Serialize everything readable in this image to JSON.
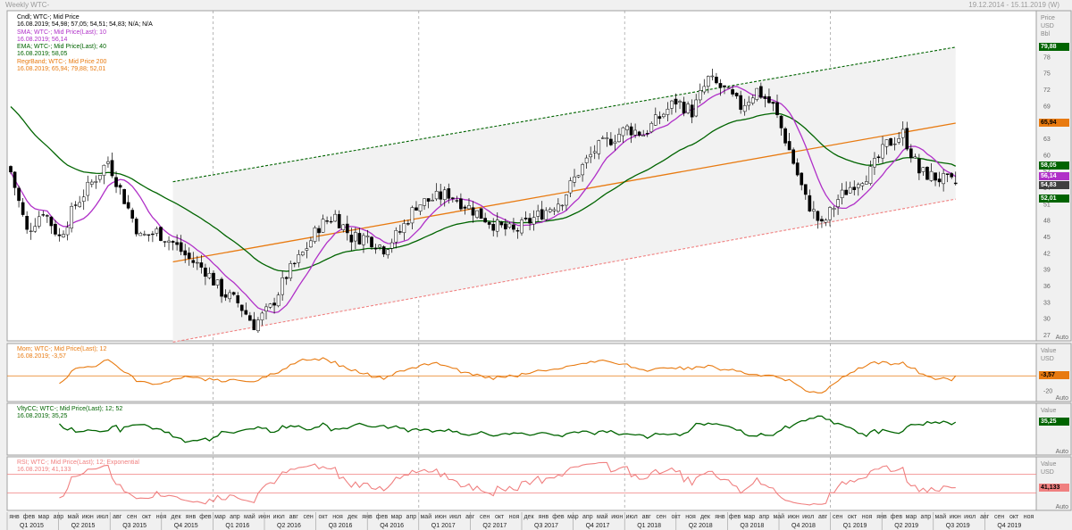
{
  "window": {
    "title": "Weekly WTC-",
    "range": "19.12.2014 - 15.11.2019 (W)"
  },
  "price_axis_header": [
    "Price",
    "USD",
    "Bbl"
  ],
  "value_axis_header": [
    "Value",
    "USD"
  ],
  "auto_label": "Auto",
  "legends": {
    "main": [
      {
        "text": "Cndl; WTC-; Mid Price",
        "color": "#000000"
      },
      {
        "text": "16.08.2019; 54,98; 57,05; 54,51; 54,83; N/A; N/A",
        "color": "#000000"
      },
      {
        "text": "SMA; WTC-; Mid Price(Last); 10",
        "color": "#b030c8"
      },
      {
        "text": "16.08.2019; 56,14",
        "color": "#b030c8"
      },
      {
        "text": "EMA; WTC-; Mid Price(Last); 40",
        "color": "#006400"
      },
      {
        "text": "16.08.2019; 58,05",
        "color": "#006400"
      },
      {
        "text": "RegrBand; WTC-; Mid Price 200",
        "color": "#e87a10"
      },
      {
        "text": "16.08.2019; 65,94; 79,88; 52,01",
        "color": "#e87a10"
      }
    ],
    "mom": [
      {
        "text": "Mom; WTC-; Mid Price(Last); 12",
        "color": "#e87a10"
      },
      {
        "text": "16.08.2019; -3,57",
        "color": "#e87a10"
      }
    ],
    "vhf": [
      {
        "text": "VltyCC; WTC-; Mid Price(Last); 12; 52",
        "color": "#006400"
      },
      {
        "text": "16.08.2019; 35,25",
        "color": "#006400"
      }
    ],
    "rsi": [
      {
        "text": "RSI; WTC-; Mid Price(Last); 12; Exponential",
        "color": "#f08080"
      },
      {
        "text": "16.08.2019; 41,133",
        "color": "#f08080"
      }
    ]
  },
  "badges": [
    {
      "id": "b1",
      "text": "79,88",
      "bg": "#006400",
      "fg": "#ffffff"
    },
    {
      "id": "b2",
      "text": "65,94",
      "bg": "#e87a10",
      "fg": "#000000"
    },
    {
      "id": "b3",
      "text": "58,05",
      "bg": "#006400",
      "fg": "#ffffff"
    },
    {
      "id": "b4",
      "text": "56,14",
      "bg": "#b030c8",
      "fg": "#ffffff"
    },
    {
      "id": "b5",
      "text": "54,83",
      "bg": "#404040",
      "fg": "#ffffff"
    },
    {
      "id": "b6",
      "text": "52,01",
      "bg": "#006400",
      "fg": "#ffffff"
    },
    {
      "id": "b7",
      "text": "-3,57",
      "bg": "#e87a10",
      "fg": "#000000"
    },
    {
      "id": "b8",
      "text": "35,25",
      "bg": "#006400",
      "fg": "#ffffff"
    },
    {
      "id": "b9",
      "text": "41,133",
      "bg": "#f08080",
      "fg": "#000000"
    }
  ],
  "colors": {
    "candle_up": "#ffffff",
    "candle_down": "#000000",
    "sma": "#b030c8",
    "ema": "#006400",
    "regr_mid": "#e87a10",
    "regr_upper": "#006400",
    "regr_lower": "#f08080",
    "mom": "#e87a10",
    "vhf": "#006400",
    "rsi": "#f08080",
    "rsi_levels": "#f08080"
  },
  "chart_data": {
    "type": "candlestick",
    "interval": "weekly",
    "instrument": "WTC-",
    "price_axis": {
      "min": 27,
      "max": 81,
      "ticks": [
        27,
        30,
        33,
        36,
        39,
        42,
        45,
        48,
        51,
        54,
        57,
        60,
        63,
        66,
        69,
        72,
        75,
        78
      ]
    },
    "mom_axis": {
      "min": -27,
      "max": 27,
      "ticks": [
        -20
      ]
    },
    "rsi_axis": {
      "levels": [
        30,
        70
      ]
    },
    "months": [
      "янв",
      "фев",
      "мар",
      "апр",
      "май",
      "июн",
      "июл",
      "авг",
      "сен",
      "окт",
      "ноя",
      "дек",
      "янв",
      "фев",
      "мар",
      "апр",
      "май",
      "июн",
      "июл",
      "авг",
      "сен",
      "окт",
      "ноя",
      "дек",
      "янв",
      "фев",
      "мар",
      "апр",
      "май",
      "июн",
      "июл",
      "авг",
      "сен",
      "окт",
      "ноя",
      "дек",
      "янв",
      "фев",
      "мар",
      "апр",
      "май",
      "июн",
      "июл",
      "авг",
      "сен",
      "окт",
      "ноя",
      "дек",
      "янв",
      "фев",
      "мар",
      "апр",
      "май",
      "июн",
      "июл",
      "авг",
      "сен",
      "окт",
      "ноя",
      "янв",
      "фев",
      "мар",
      "апр",
      "май",
      "июн",
      "июл",
      "авг",
      "сен",
      "окт",
      "ноя"
    ],
    "quarters": [
      "Q1 2015",
      "Q2 2015",
      "Q3 2015",
      "Q4 2015",
      "Q1 2016",
      "Q2 2016",
      "Q3 2016",
      "Q4 2016",
      "Q1 2017",
      "Q2 2017",
      "Q3 2017",
      "Q4 2017",
      "Q1 2018",
      "Q2 2018",
      "Q3 2018",
      "Q4 2018",
      "Q1 2019",
      "Q2 2019",
      "Q3 2019",
      "Q4 2019"
    ],
    "price_anchors": [
      [
        0,
        57
      ],
      [
        4,
        46
      ],
      [
        8,
        50
      ],
      [
        12,
        45
      ],
      [
        16,
        51
      ],
      [
        20,
        55
      ],
      [
        24,
        59
      ],
      [
        28,
        52
      ],
      [
        32,
        45
      ],
      [
        36,
        46
      ],
      [
        40,
        44
      ],
      [
        44,
        41
      ],
      [
        48,
        39
      ],
      [
        52,
        35
      ],
      [
        56,
        33
      ],
      [
        60,
        29
      ],
      [
        64,
        32
      ],
      [
        68,
        38
      ],
      [
        72,
        42
      ],
      [
        76,
        47
      ],
      [
        80,
        49
      ],
      [
        84,
        45
      ],
      [
        88,
        45
      ],
      [
        92,
        43
      ],
      [
        96,
        46
      ],
      [
        100,
        51
      ],
      [
        104,
        52
      ],
      [
        108,
        53
      ],
      [
        112,
        51
      ],
      [
        116,
        49
      ],
      [
        120,
        47
      ],
      [
        124,
        46
      ],
      [
        128,
        48
      ],
      [
        132,
        50
      ],
      [
        136,
        52
      ],
      [
        140,
        57
      ],
      [
        144,
        61
      ],
      [
        148,
        63
      ],
      [
        152,
        65
      ],
      [
        156,
        64
      ],
      [
        160,
        67
      ],
      [
        164,
        70
      ],
      [
        168,
        68
      ],
      [
        172,
        74
      ],
      [
        176,
        72
      ],
      [
        180,
        69
      ],
      [
        184,
        72
      ],
      [
        188,
        69
      ],
      [
        192,
        61
      ],
      [
        196,
        52
      ],
      [
        200,
        47
      ],
      [
        204,
        52
      ],
      [
        208,
        55
      ],
      [
        212,
        57
      ],
      [
        216,
        62
      ],
      [
        220,
        64
      ],
      [
        224,
        57
      ],
      [
        228,
        56
      ],
      [
        232,
        55
      ],
      [
        233,
        54.83
      ]
    ],
    "regression_band": {
      "start": {
        "mid": 40.5,
        "upper": 55.2,
        "lower": 25.8
      },
      "end": {
        "mid": 65.94,
        "upper": 79.88,
        "lower": 52.01
      }
    },
    "last_values": {
      "date": "16.08.2019",
      "open": 54.98,
      "high": 57.05,
      "low": 54.51,
      "close": 54.83,
      "sma": 56.14,
      "ema": 58.05,
      "regr_mid": 65.94,
      "regr_upper": 79.88,
      "regr_lower": 52.01,
      "mom": -3.57,
      "vhf": 35.25,
      "rsi": 41.133
    }
  }
}
